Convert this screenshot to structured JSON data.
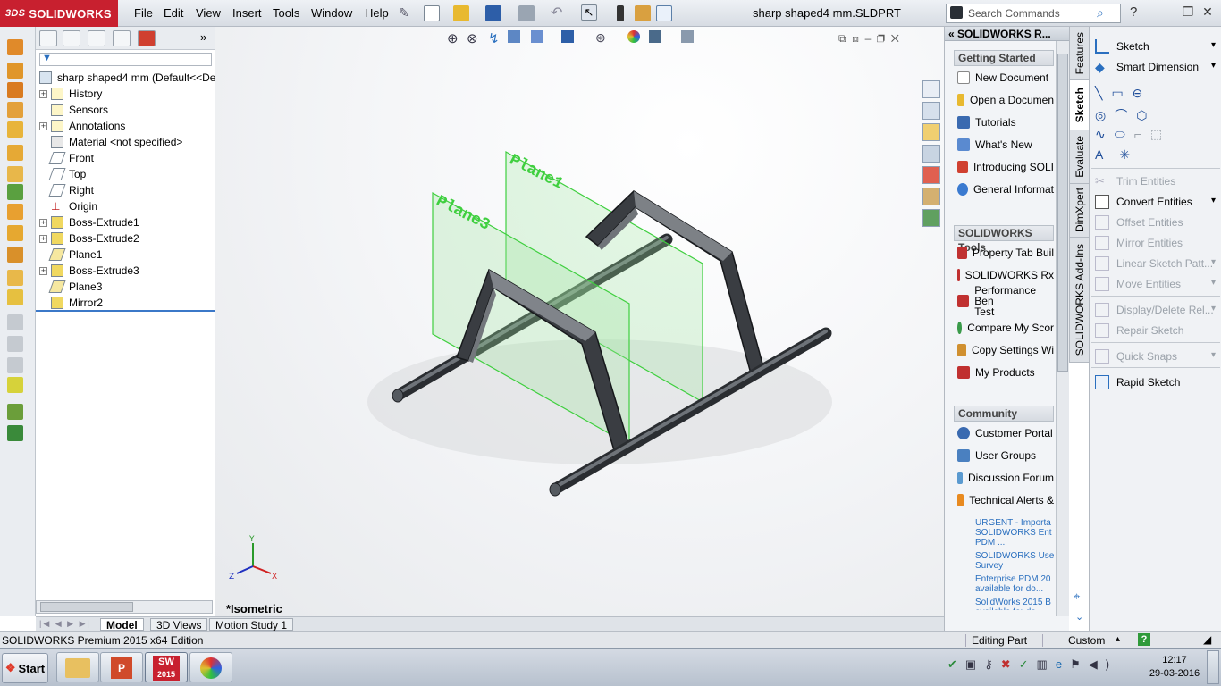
{
  "app": {
    "name": "SOLIDWORKS",
    "title": "sharp shaped4 mm.SLDPRT"
  },
  "menu": [
    "File",
    "Edit",
    "View",
    "Insert",
    "Tools",
    "Window",
    "Help"
  ],
  "search": {
    "placeholder": "Search Commands"
  },
  "tree": {
    "root": "sharp shaped4 mm  (Default<<Defau",
    "items": [
      "History",
      "Sensors",
      "Annotations",
      "Material <not specified>",
      "Front",
      "Top",
      "Right",
      "Origin",
      "Boss-Extrude1",
      "Boss-Extrude2",
      "Plane1",
      "Boss-Extrude3",
      "Plane3",
      "Mirror2"
    ]
  },
  "viewport": {
    "view_name": "*Isometric",
    "planes": [
      "Plane1",
      "Plane3"
    ]
  },
  "bottom_tabs": [
    "Model",
    "3D Views",
    "Motion Study 1"
  ],
  "status": {
    "edition": "SOLIDWORKS Premium 2015 x64 Edition",
    "mode": "Editing Part",
    "units": "Custom"
  },
  "taskpane": {
    "title": "SOLIDWORKS R...",
    "getting_started": {
      "header": "Getting Started",
      "items": [
        "New Document",
        "Open a Documen",
        "Tutorials",
        "What's New",
        "Introducing SOLI",
        "General Informat"
      ]
    },
    "tools": {
      "header": "SOLIDWORKS Tools",
      "items": [
        "Property Tab Buil",
        "SOLIDWORKS Rx",
        "Performance Ben\nTest",
        "Compare My Scor",
        "Copy Settings Wi",
        "My Products"
      ]
    },
    "community": {
      "header": "Community",
      "items": [
        "Customer Portal",
        "User Groups",
        "Discussion Forum",
        "Technical Alerts &"
      ]
    },
    "news": [
      "URGENT - Importa\nSOLIDWORKS Ent\nPDM ...",
      "SOLIDWORKS Use\nSurvey",
      "Enterprise PDM 20\navailable for do...",
      "SolidWorks 2015 B\navailable for do..."
    ]
  },
  "vtabs": [
    "Features",
    "Sketch",
    "Evaluate",
    "DimXpert",
    "SOLIDWORKS Add-Ins"
  ],
  "sketch_panel": {
    "items": [
      "Sketch",
      "Smart Dimension",
      "Trim Entities",
      "Convert Entities",
      "Offset Entities",
      "Mirror Entities",
      "Linear Sketch Patt...",
      "Move Entities",
      "Display/Delete Rel...",
      "Repair Sketch",
      "Quick Snaps",
      "Rapid Sketch"
    ]
  },
  "taskbar": {
    "start": "Start",
    "time": "12:17",
    "date": "29-03-2016",
    "sw_badge": "2015"
  },
  "colors": {
    "brand": "#c8202f",
    "plane": "#3fcf3f",
    "accent": "#2a6fbf"
  }
}
